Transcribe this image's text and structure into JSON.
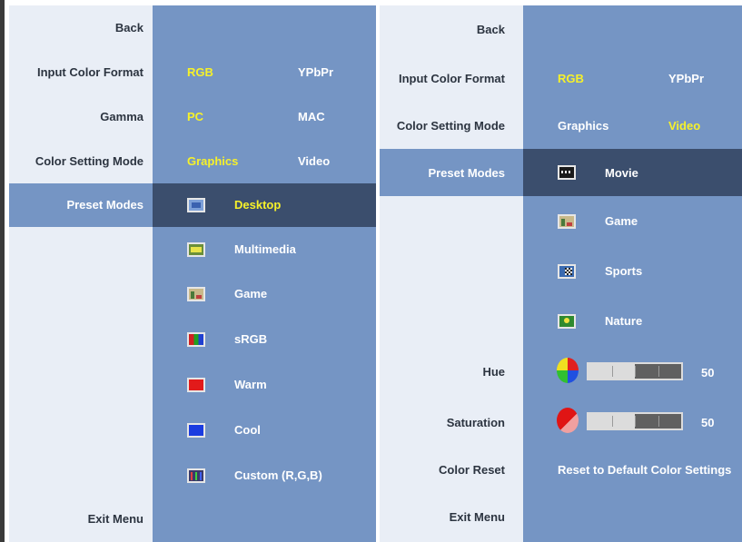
{
  "left_menu": {
    "back": "Back",
    "input_color_format": {
      "label": "Input Color Format",
      "options": [
        "RGB",
        "YPbPr"
      ],
      "selected": "RGB"
    },
    "gamma": {
      "label": "Gamma",
      "options": [
        "PC",
        "MAC"
      ],
      "selected": "PC"
    },
    "color_setting_mode": {
      "label": "Color Setting Mode",
      "options": [
        "Graphics",
        "Video"
      ],
      "selected": "Graphics"
    },
    "preset_modes": {
      "label": "Preset Modes",
      "items": [
        {
          "label": "Desktop",
          "icon": "desktop-icon",
          "selected": true
        },
        {
          "label": "Multimedia",
          "icon": "multimedia-icon"
        },
        {
          "label": "Game",
          "icon": "game-icon"
        },
        {
          "label": "sRGB",
          "icon": "srgb-icon"
        },
        {
          "label": "Warm",
          "icon": "warm-icon"
        },
        {
          "label": "Cool",
          "icon": "cool-icon"
        },
        {
          "label": "Custom (R,G,B)",
          "icon": "custom-rgb-icon"
        }
      ]
    },
    "exit": "Exit Menu"
  },
  "right_menu": {
    "back": "Back",
    "input_color_format": {
      "label": "Input Color Format",
      "options": [
        "RGB",
        "YPbPr"
      ],
      "selected": "RGB"
    },
    "color_setting_mode": {
      "label": "Color Setting Mode",
      "options": [
        "Graphics",
        "Video"
      ],
      "selected": "Video"
    },
    "preset_modes": {
      "label": "Preset Modes",
      "items": [
        {
          "label": "Movie",
          "icon": "movie-icon",
          "selected": true
        },
        {
          "label": "Game",
          "icon": "game-icon"
        },
        {
          "label": "Sports",
          "icon": "sports-icon"
        },
        {
          "label": "Nature",
          "icon": "nature-icon"
        }
      ]
    },
    "hue": {
      "label": "Hue",
      "value": 50,
      "display": "50"
    },
    "saturation": {
      "label": "Saturation",
      "value": 50,
      "display": "50"
    },
    "color_reset": {
      "label": "Color Reset",
      "action": "Reset to Default Color Settings"
    },
    "exit": "Exit Menu"
  },
  "colors": {
    "left_bg": "#e9eef6",
    "right_bg": "#7595c4",
    "selected_row": "#3b4e6d",
    "active_option": "#f6f12a"
  }
}
